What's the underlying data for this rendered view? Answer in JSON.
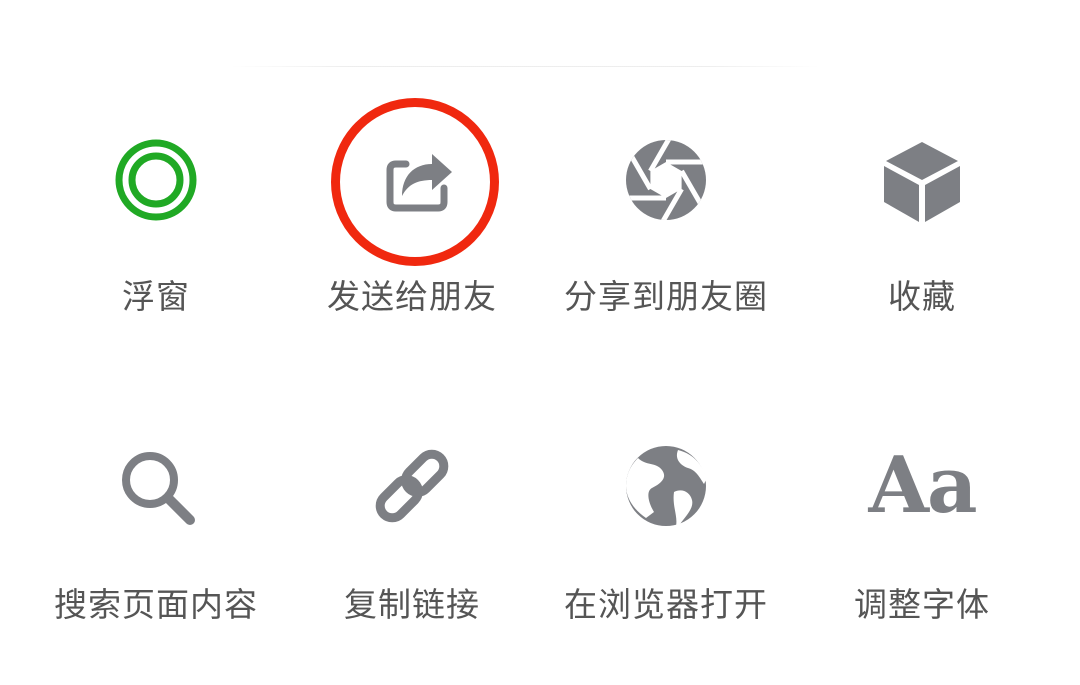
{
  "menu": {
    "row1": [
      {
        "id": "float-window",
        "label": "浮窗",
        "icon": "concentric-rings-icon",
        "color": "#20a924"
      },
      {
        "id": "send-to-friend",
        "label": "发送给朋友",
        "icon": "share-arrow-icon",
        "color": "#7d7f84"
      },
      {
        "id": "share-moments",
        "label": "分享到朋友圈",
        "icon": "aperture-icon",
        "color": "#7d7f84"
      },
      {
        "id": "favorite",
        "label": "收藏",
        "icon": "cube-icon",
        "color": "#7d7f84"
      }
    ],
    "row2": [
      {
        "id": "search-page",
        "label": "搜索页面内容",
        "icon": "search-icon",
        "color": "#7d7f84"
      },
      {
        "id": "copy-link",
        "label": "复制链接",
        "icon": "link-icon",
        "color": "#7d7f84"
      },
      {
        "id": "open-browser",
        "label": "在浏览器打开",
        "icon": "globe-icon",
        "color": "#7d7f84"
      },
      {
        "id": "font-size",
        "label": "调整字体",
        "icon": "font-icon",
        "icon_text": "Aa",
        "color": "#7d7f84"
      }
    ]
  },
  "highlight": {
    "target": "send-to-friend",
    "color": "#f0280f"
  }
}
